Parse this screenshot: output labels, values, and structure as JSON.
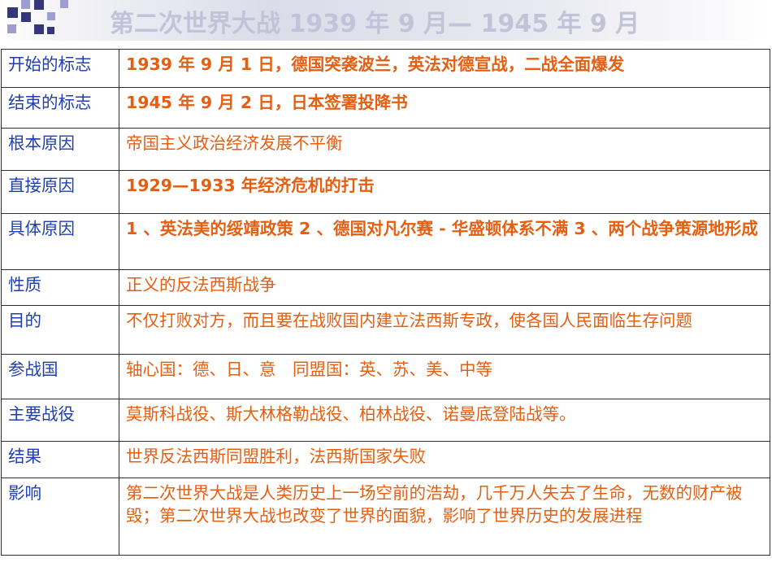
{
  "slide": {
    "title": "第二次世界大战 1939 年 9 月— 1945 年 9 月",
    "colors": {
      "label": "#1f3fae",
      "value": "#e55f12",
      "title": "#c2c2d8",
      "border": "#2e2e2e",
      "square_dark": "#35357a",
      "square_light": "#9d9dcf"
    }
  },
  "table": {
    "rows": [
      {
        "label": "开始的标志",
        "value": "1939 年 9 月 1 日，德国突袭波兰，英法对德宣战，二战全面爆发"
      },
      {
        "label": "结束的标志",
        "value": "1945 年 9 月 2 日，日本签署投降书"
      },
      {
        "label": "根本原因",
        "value": "帝国主义政治经济发展不平衡"
      },
      {
        "label": "直接原因",
        "value": "1929—1933 年经济危机的打击"
      },
      {
        "label": "具体原因",
        "value": "1 、英法美的绥靖政策 2 、德国对凡尔赛 - 华盛顿体系不满 3 、两个战争策源地形成"
      },
      {
        "label": "性质",
        "value": "正义的反法西斯战争"
      },
      {
        "label": "目的",
        "value": "不仅打败对方，而且要在战败国内建立法西斯专政，使各国人民面临生存问题"
      },
      {
        "label": "参战国",
        "value": "轴心国：德、日、意　同盟国：英、苏、美、中等"
      },
      {
        "label": "主要战役",
        "value": "莫斯科战役、斯大林格勒战役、柏林战役、诺曼底登陆战等。"
      },
      {
        "label": "结果",
        "value": "世界反法西斯同盟胜利，法西斯国家失败"
      },
      {
        "label": "影响",
        "value": "第二次世界大战是人类历史上一场空前的浩劫，几千万人失去了生命，无数的财产被毁；第二次世界大战也改变了世界的面貌，影响了世界历史的发展进程"
      }
    ]
  }
}
